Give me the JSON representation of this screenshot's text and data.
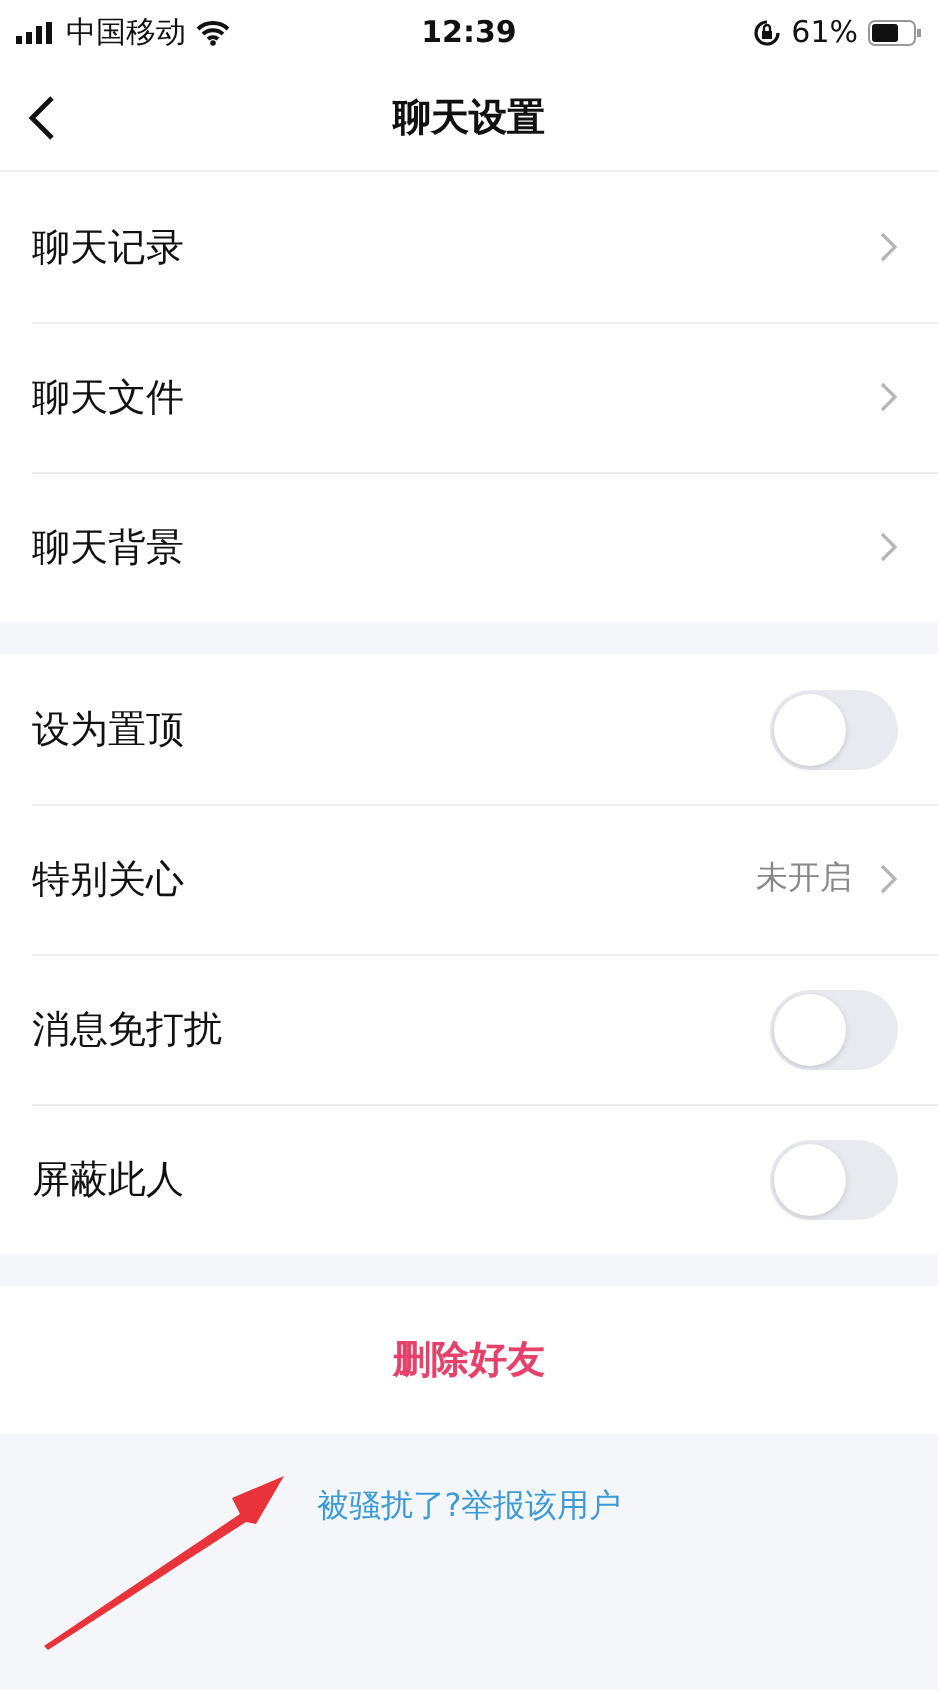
{
  "status_bar": {
    "carrier": "中国移动",
    "time": "12:39",
    "battery": "61%"
  },
  "nav": {
    "title": "聊天设置"
  },
  "groups": [
    {
      "rows": [
        {
          "kind": "link",
          "label": "聊天记录"
        },
        {
          "kind": "link",
          "label": "聊天文件"
        },
        {
          "kind": "link",
          "label": "聊天背景"
        }
      ]
    },
    {
      "rows": [
        {
          "kind": "toggle",
          "label": "设为置顶",
          "on": false
        },
        {
          "kind": "link",
          "label": "特别关心",
          "value": "未开启"
        },
        {
          "kind": "toggle",
          "label": "消息免打扰",
          "on": false
        },
        {
          "kind": "toggle",
          "label": "屏蔽此人",
          "on": false
        }
      ]
    }
  ],
  "delete_button": "删除好友",
  "report_link": "被骚扰了?举报该用户"
}
